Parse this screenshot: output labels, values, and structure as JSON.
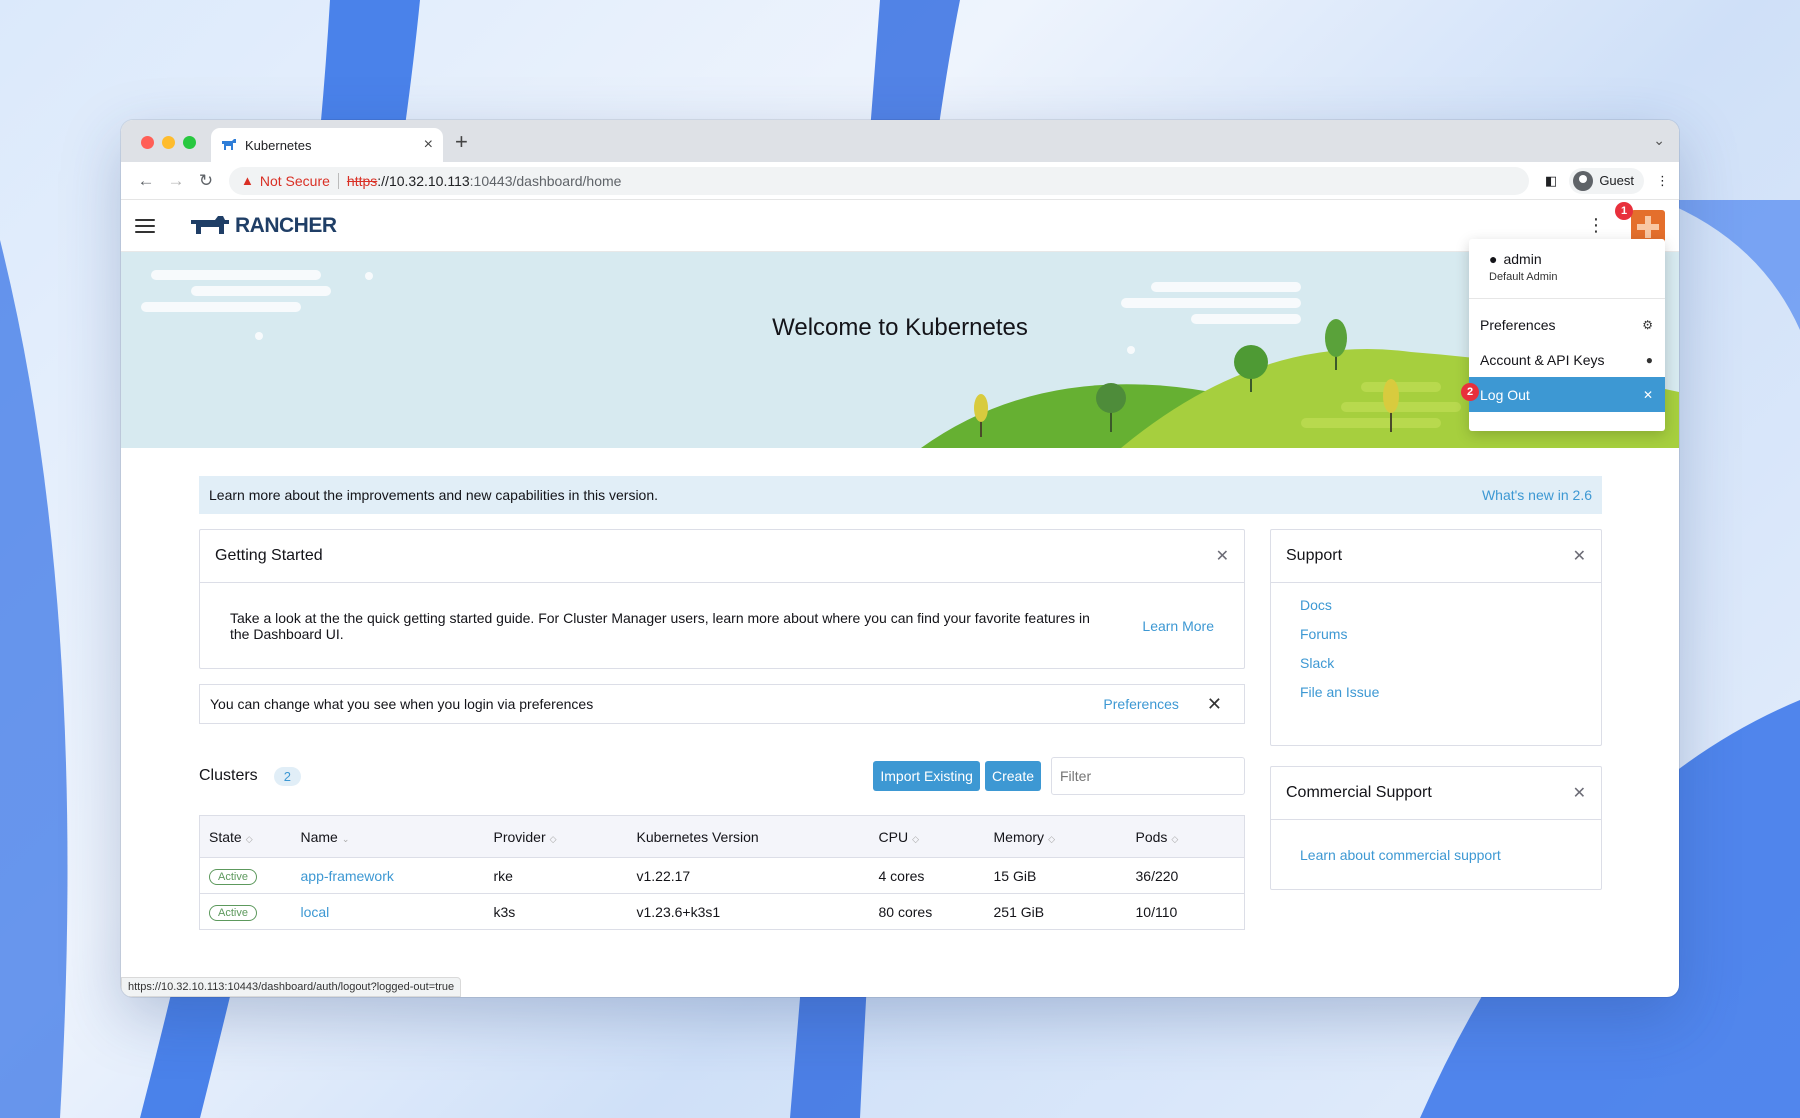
{
  "browser": {
    "tab_title": "Kubernetes",
    "tab_close": "×",
    "new_tab": "+",
    "security_label": "Not Secure",
    "url_scheme": "https",
    "url_host": "://10.32.10.113",
    "url_path": ":10443/dashboard/home",
    "profile_label": "Guest",
    "status_url": "https://10.32.10.113:10443/dashboard/auth/logout?logged-out=true"
  },
  "header": {
    "logo_text": "RANCHER"
  },
  "banner": {
    "title": "Welcome to Kubernetes"
  },
  "steps": {
    "one": "1",
    "two": "2"
  },
  "user_menu": {
    "username": "admin",
    "role": "Default Admin",
    "items": [
      {
        "label": "Preferences",
        "icon": "gear-icon"
      },
      {
        "label": "Account & API Keys",
        "icon": "user-icon"
      },
      {
        "label": "Log Out",
        "icon": "close-icon"
      }
    ]
  },
  "notice": {
    "text": "Learn more about the improvements and new capabilities in this version.",
    "link": "What's new in 2.6"
  },
  "getting_started": {
    "title": "Getting Started",
    "body": "Take a look at the the quick getting started guide. For Cluster Manager users, learn more about where you can find your favorite features in the Dashboard UI.",
    "link": "Learn More"
  },
  "prefs_bar": {
    "text": "You can change what you see when you login via preferences",
    "link": "Preferences"
  },
  "clusters": {
    "title": "Clusters",
    "count": "2",
    "import_button": "Import Existing",
    "create_button": "Create",
    "filter_placeholder": "Filter",
    "columns": [
      "State",
      "Name",
      "Provider",
      "Kubernetes Version",
      "CPU",
      "Memory",
      "Pods"
    ],
    "rows": [
      {
        "state": "Active",
        "name": "app-framework",
        "provider": "rke",
        "version": "v1.22.17",
        "cpu": "4 cores",
        "memory": "15 GiB",
        "pods": "36/220"
      },
      {
        "state": "Active",
        "name": "local",
        "provider": "k3s",
        "version": "v1.23.6+k3s1",
        "cpu": "80 cores",
        "memory": "251 GiB",
        "pods": "10/110"
      }
    ]
  },
  "support": {
    "title": "Support",
    "links": [
      "Docs",
      "Forums",
      "Slack",
      "File an Issue"
    ]
  },
  "commercial": {
    "title": "Commercial Support",
    "link": "Learn about commercial support"
  },
  "colors": {
    "accent": "#3d98d3",
    "badge": "#e8303c",
    "active_state": "#5d995d",
    "avatar": "#e46f2c"
  }
}
